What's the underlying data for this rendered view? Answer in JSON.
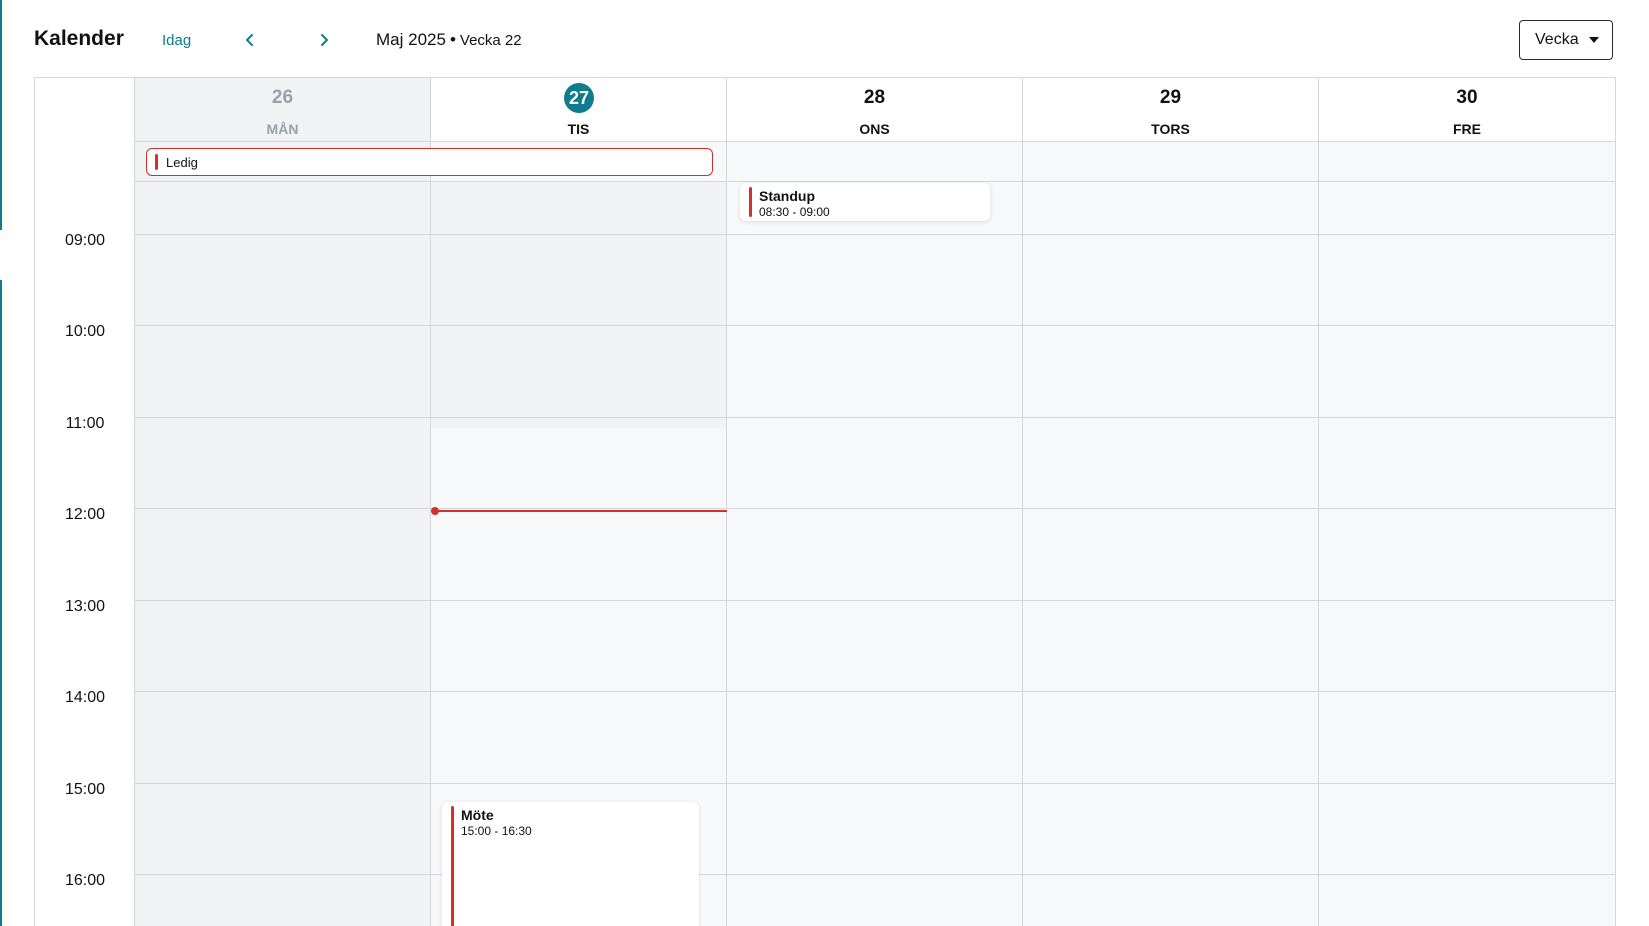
{
  "header": {
    "title": "Kalender",
    "today_label": "Idag",
    "prev_icon": "chevron-left-icon",
    "next_icon": "chevron-right-icon",
    "period_label": "Maj 2025",
    "separator": "•",
    "week_label": "Vecka 22",
    "view_selected": "Vecka"
  },
  "colors": {
    "accent": "#0e7c8c",
    "event": "#d32f2f",
    "grid_line": "#d3d6db",
    "past_bg": "#f1f2f4"
  },
  "days": [
    {
      "num": "26",
      "name": "MÅN"
    },
    {
      "num": "27",
      "name": "TIS"
    },
    {
      "num": "28",
      "name": "ONS"
    },
    {
      "num": "29",
      "name": "TORS"
    },
    {
      "num": "30",
      "name": "FRE"
    }
  ],
  "times": [
    "09:00",
    "10:00",
    "11:00",
    "12:00",
    "13:00",
    "14:00",
    "15:00",
    "16:00"
  ],
  "events": {
    "allday": {
      "title": "Ledig"
    },
    "standup": {
      "title": "Standup",
      "time": "08:30 - 09:00"
    },
    "mote": {
      "title": "Möte",
      "time": "15:00 - 16:30"
    }
  }
}
